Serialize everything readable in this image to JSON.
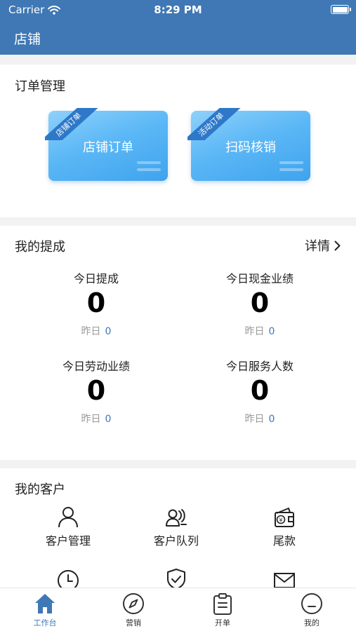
{
  "status_bar": {
    "carrier": "Carrier",
    "time": "8:29 PM"
  },
  "header": {
    "title": "店铺"
  },
  "orders": {
    "title": "订单管理",
    "cards": [
      {
        "ribbon": "店铺订单",
        "label": "店铺订单"
      },
      {
        "ribbon": "活动订单",
        "label": "扫码核销"
      }
    ]
  },
  "commission": {
    "title": "我的提成",
    "detail_label": "详情",
    "stats": [
      {
        "label": "今日提成",
        "value": "0",
        "yesterday_label": "昨日",
        "yesterday_value": "0"
      },
      {
        "label": "今日现金业绩",
        "value": "0",
        "yesterday_label": "昨日",
        "yesterday_value": "0"
      },
      {
        "label": "今日劳动业绩",
        "value": "0",
        "yesterday_label": "昨日",
        "yesterday_value": "0"
      },
      {
        "label": "今日服务人数",
        "value": "0",
        "yesterday_label": "昨日",
        "yesterday_value": "0"
      }
    ]
  },
  "customers": {
    "title": "我的客户",
    "items": [
      {
        "label": "客户管理",
        "icon": "person-icon"
      },
      {
        "label": "客户队列",
        "icon": "people-queue-icon"
      },
      {
        "label": "尾款",
        "icon": "wallet-icon"
      },
      {
        "label": "",
        "icon": "clock-icon"
      },
      {
        "label": "",
        "icon": "shield-check-icon"
      },
      {
        "label": "",
        "icon": "mail-icon"
      }
    ]
  },
  "tabbar": {
    "active_color": "#3f78b5",
    "tabs": [
      {
        "label": "工作台",
        "icon": "home-icon",
        "active": true
      },
      {
        "label": "营销",
        "icon": "compass-icon",
        "active": false
      },
      {
        "label": "开单",
        "icon": "clipboard-icon",
        "active": false
      },
      {
        "label": "我的",
        "icon": "face-icon",
        "active": false
      }
    ]
  },
  "colors": {
    "brand": "#3f78b5",
    "card_gradient_start": "#8fd1fb",
    "card_gradient_end": "#3fa3ee"
  }
}
